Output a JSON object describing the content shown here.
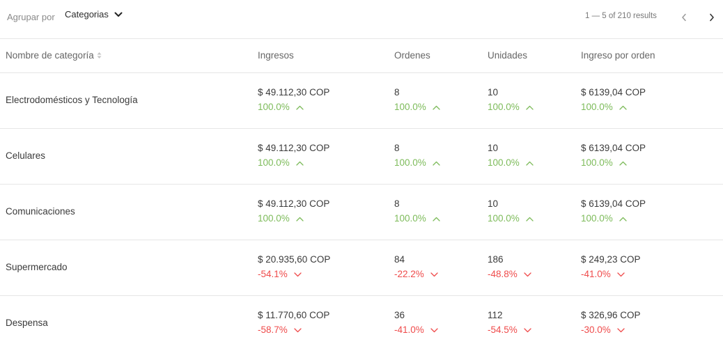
{
  "toolbar": {
    "group_label": "Agrupar por",
    "group_value": "Categorias",
    "pagination_text": "1 — 5 of 210 results"
  },
  "table": {
    "headers": {
      "category": "Nombre de categoría",
      "revenue": "Ingresos",
      "orders": "Ordenes",
      "units": "Unidades",
      "revenue_per_order": "Ingreso por orden"
    },
    "rows": [
      {
        "category": "Electrodomésticos y Tecnología",
        "revenue": "$ 49.112,30 COP",
        "revenue_pct": "100.0%",
        "revenue_trend": "up",
        "orders": "8",
        "orders_pct": "100.0%",
        "orders_trend": "up",
        "units": "10",
        "units_pct": "100.0%",
        "units_trend": "up",
        "rpo": "$ 6139,04 COP",
        "rpo_pct": "100.0%",
        "rpo_trend": "up"
      },
      {
        "category": "Celulares",
        "revenue": "$ 49.112,30 COP",
        "revenue_pct": "100.0%",
        "revenue_trend": "up",
        "orders": "8",
        "orders_pct": "100.0%",
        "orders_trend": "up",
        "units": "10",
        "units_pct": "100.0%",
        "units_trend": "up",
        "rpo": "$ 6139,04 COP",
        "rpo_pct": "100.0%",
        "rpo_trend": "up"
      },
      {
        "category": "Comunicaciones",
        "revenue": "$ 49.112,30 COP",
        "revenue_pct": "100.0%",
        "revenue_trend": "up",
        "orders": "8",
        "orders_pct": "100.0%",
        "orders_trend": "up",
        "units": "10",
        "units_pct": "100.0%",
        "units_trend": "up",
        "rpo": "$ 6139,04 COP",
        "rpo_pct": "100.0%",
        "rpo_trend": "up"
      },
      {
        "category": "Supermercado",
        "revenue": "$ 20.935,60 COP",
        "revenue_pct": "-54.1%",
        "revenue_trend": "down",
        "orders": "84",
        "orders_pct": "-22.2%",
        "orders_trend": "down",
        "units": "186",
        "units_pct": "-48.8%",
        "units_trend": "down",
        "rpo": "$ 249,23 COP",
        "rpo_pct": "-41.0%",
        "rpo_trend": "down"
      },
      {
        "category": "Despensa",
        "revenue": "$ 11.770,60 COP",
        "revenue_pct": "-58.7%",
        "revenue_trend": "down",
        "orders": "36",
        "orders_pct": "-41.0%",
        "orders_trend": "down",
        "units": "112",
        "units_pct": "-54.5%",
        "units_trend": "down",
        "rpo": "$ 326,96 COP",
        "rpo_pct": "-30.0%",
        "rpo_trend": "down"
      }
    ]
  },
  "colors": {
    "up": "#7dbb5a",
    "down": "#ef4b4b",
    "border": "#e6e6e6"
  },
  "icons": {
    "trend_up": "chevron-up-icon",
    "trend_down": "chevron-down-icon",
    "sort": "sort-icon",
    "select": "chevron-down-icon",
    "prev": "chevron-left-icon",
    "next": "chevron-right-icon"
  }
}
